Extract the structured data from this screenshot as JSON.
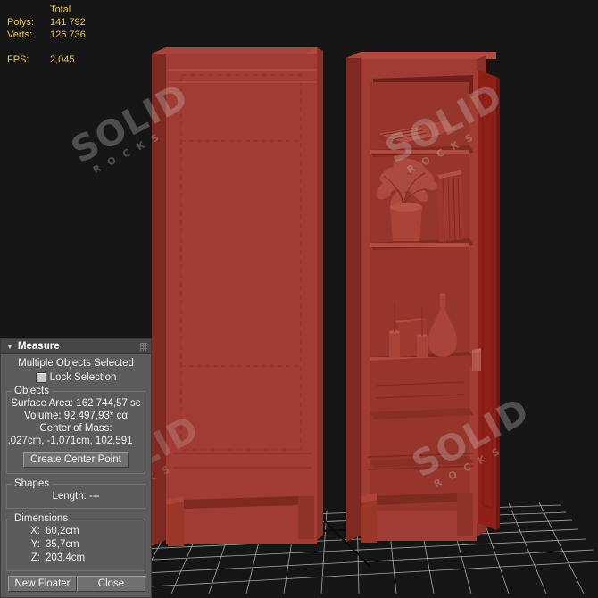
{
  "stats": {
    "header": "Total",
    "rows": [
      {
        "label": "Polys:",
        "value": "141 792"
      },
      {
        "label": "Verts:",
        "value": "126 736"
      }
    ],
    "fps_label": "FPS:",
    "fps_value": "2,045"
  },
  "watermark": {
    "line1": "SOLID",
    "line2": "R O C K S"
  },
  "panel": {
    "title": "Measure",
    "collapse_arrow": "▼",
    "selection_status": "Multiple Objects Selected",
    "lock_selection_label": "Lock Selection",
    "objects": {
      "group_label": "Objects",
      "surface_area": "Surface Area: 162 744,57 sc",
      "volume": "Volume: 92 497,93* cα",
      "center_of_mass_label": "Center of Mass:",
      "center_of_mass_value": ",027cm, -1,071cm, 102,591",
      "create_center_point": "Create Center Point"
    },
    "shapes": {
      "group_label": "Shapes",
      "length_label": "Length:",
      "length_value": "---"
    },
    "dimensions": {
      "group_label": "Dimensions",
      "rows": [
        {
          "axis": "X:",
          "value": "60,2cm"
        },
        {
          "axis": "Y:",
          "value": "35,7cm"
        },
        {
          "axis": "Z:",
          "value": "203,4cm"
        }
      ]
    },
    "buttons": {
      "new_floater": "New Floater",
      "close": "Close"
    }
  },
  "colors": {
    "viewport_bg": "#161616",
    "cabinet_red": "#a03c33",
    "door_dark_red": "#8e2018",
    "panel_bg": "#5c5c5c",
    "stats_yellow": "#e8c84a",
    "grid_line": "#c8c8c8",
    "axis_line": "#101010"
  },
  "scene": {
    "objects": [
      {
        "name": "closed-cabinet",
        "state": "closed"
      },
      {
        "name": "open-cabinet",
        "state": "open-with-contents"
      }
    ]
  }
}
